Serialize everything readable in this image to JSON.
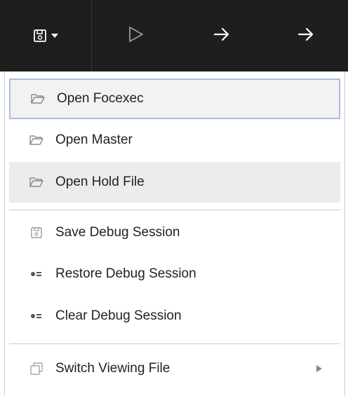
{
  "toolbar": {
    "buttons": [
      "save-menu",
      "run",
      "step-over",
      "step-into"
    ]
  },
  "menu": {
    "items": [
      {
        "label": "Open Focexec",
        "icon": "folder-icon"
      },
      {
        "label": "Open Master",
        "icon": "folder-icon"
      },
      {
        "label": "Open Hold File",
        "icon": "folder-icon"
      },
      {
        "label": "Save Debug Session",
        "icon": "save-icon"
      },
      {
        "label": "Restore Debug Session",
        "icon": "session-icon"
      },
      {
        "label": "Clear Debug Session",
        "icon": "session-icon"
      },
      {
        "label": "Switch Viewing File",
        "icon": "copy-icon"
      }
    ]
  },
  "colors": {
    "toolbar_bg": "#1e1e1e",
    "focus_border": "#a9bde6",
    "hover_bg": "#ececec"
  }
}
